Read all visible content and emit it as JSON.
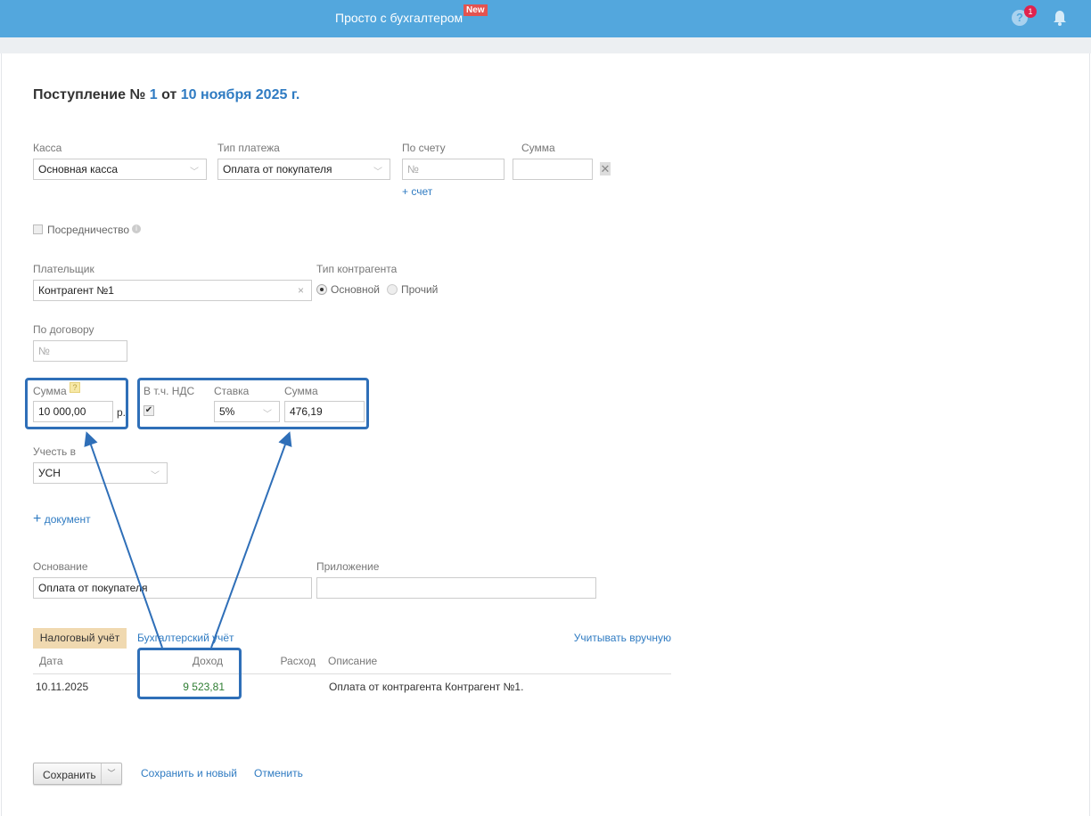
{
  "header": {
    "title": "Просто с бухгалтером",
    "new_badge": "New",
    "help_badge": "1"
  },
  "page": {
    "title_prefix": "Поступление № ",
    "number": "1",
    "title_mid": " от ",
    "date": "10 ноября 2025 г."
  },
  "fields": {
    "kassa": {
      "label": "Касса",
      "value": "Основная касса"
    },
    "payment_type": {
      "label": "Тип платежа",
      "value": "Оплата от покупателя"
    },
    "invoice": {
      "label": "По счету",
      "placeholder": "№",
      "add": "+ счет"
    },
    "invoice_sum": {
      "label": "Сумма",
      "value": ""
    },
    "mediation": {
      "label": "Посредничество",
      "checked": false
    },
    "payer": {
      "label": "Плательщик",
      "value": "Контрагент №1"
    },
    "contractor_type": {
      "label": "Тип контрагента",
      "options": [
        "Основной",
        "Прочий"
      ],
      "selected": "Основной"
    },
    "contract": {
      "label": "По договору",
      "placeholder": "№"
    },
    "amount": {
      "label": "Сумма",
      "value": "10 000,00",
      "currency": "р.",
      "help": "?"
    },
    "vat": {
      "label": "В т.ч. НДС",
      "checked": true,
      "rate_label": "Ставка",
      "rate": "5%",
      "sum_label": "Сумма",
      "sum": "476,19"
    },
    "account_in": {
      "label": "Учесть в",
      "value": "УСН"
    },
    "add_document": "документ",
    "basis": {
      "label": "Основание",
      "value": "Оплата от покупателя"
    },
    "attachment": {
      "label": "Приложение",
      "value": ""
    }
  },
  "tabs": {
    "tax": "Налоговый учёт",
    "accounting": "Бухгалтерский учёт",
    "manual": "Учитывать вручную"
  },
  "table": {
    "headers": [
      "Дата",
      "Доход",
      "Расход",
      "Описание"
    ],
    "rows": [
      {
        "date": "10.11.2025",
        "income": "9 523,81",
        "expense": "",
        "description": "Оплата от контрагента Контрагент №1."
      }
    ]
  },
  "actions": {
    "save": "Сохранить",
    "save_new": "Сохранить и новый",
    "cancel": "Отменить"
  },
  "colors": {
    "header": "#53a7dd",
    "link": "#2f7bc2",
    "annotation": "#2f6fb8",
    "income": "#2e7d32",
    "tab_active": "#f0d9b0"
  }
}
